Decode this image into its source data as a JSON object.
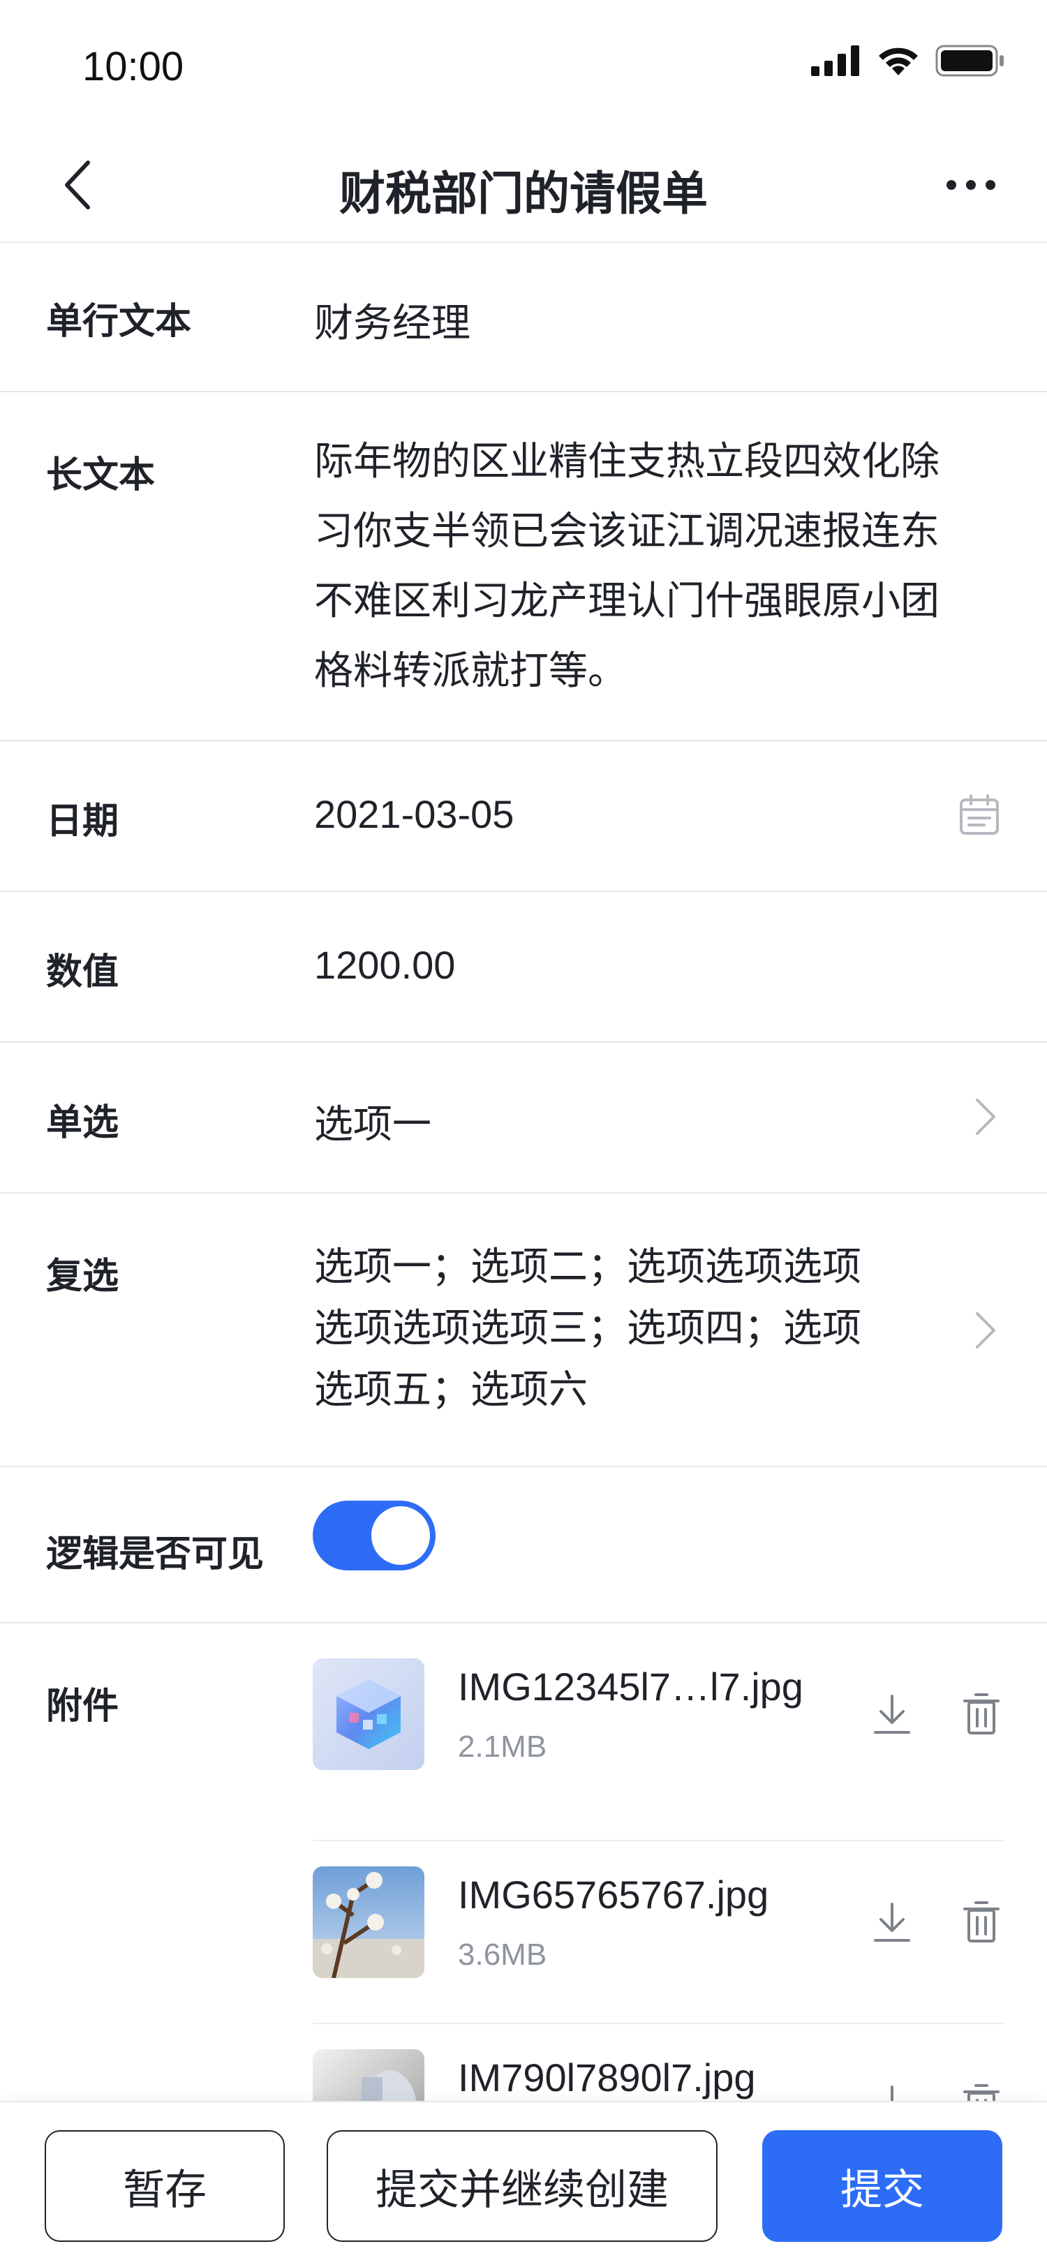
{
  "status_bar": {
    "time": "10:00"
  },
  "nav": {
    "title": "财税部门的请假单"
  },
  "form": {
    "single_text": {
      "label": "单行文本",
      "value": "财务经理"
    },
    "long_text": {
      "label": "长文本",
      "lines": [
        "际年物的区业精住支热立段四效化除",
        "习你支半领已会该证江调况速报连东",
        "不难区利习龙产理认门什强眼原小团",
        "格料转派就打等。"
      ]
    },
    "date": {
      "label": "日期",
      "value": "2021-03-05"
    },
    "number": {
      "label": "数值",
      "value": "1200.00"
    },
    "single_select": {
      "label": "单选",
      "value": "选项一"
    },
    "multi_select": {
      "label": "复选",
      "lines": [
        "选项一；选项二；选项选项选项",
        "选项选项选项三；选项四；选项",
        "选项五；选项六"
      ]
    },
    "visible_switch": {
      "label": "逻辑是否可见",
      "on": true
    },
    "attachments": {
      "label": "附件",
      "items": [
        {
          "name": "IMG12345l7…l7.jpg",
          "size": "2.1MB"
        },
        {
          "name": "IMG65765767.jpg",
          "size": "3.6MB"
        },
        {
          "name": "IM790l7890l7.jpg",
          "size": ""
        }
      ]
    }
  },
  "actions": {
    "save": "暂存",
    "submit_continue": "提交并继续创建",
    "submit": "提交"
  },
  "colors": {
    "accent": "#2d6df6",
    "text": "#1f2329",
    "muted": "#8f959e",
    "divider": "#e6e6e6"
  }
}
